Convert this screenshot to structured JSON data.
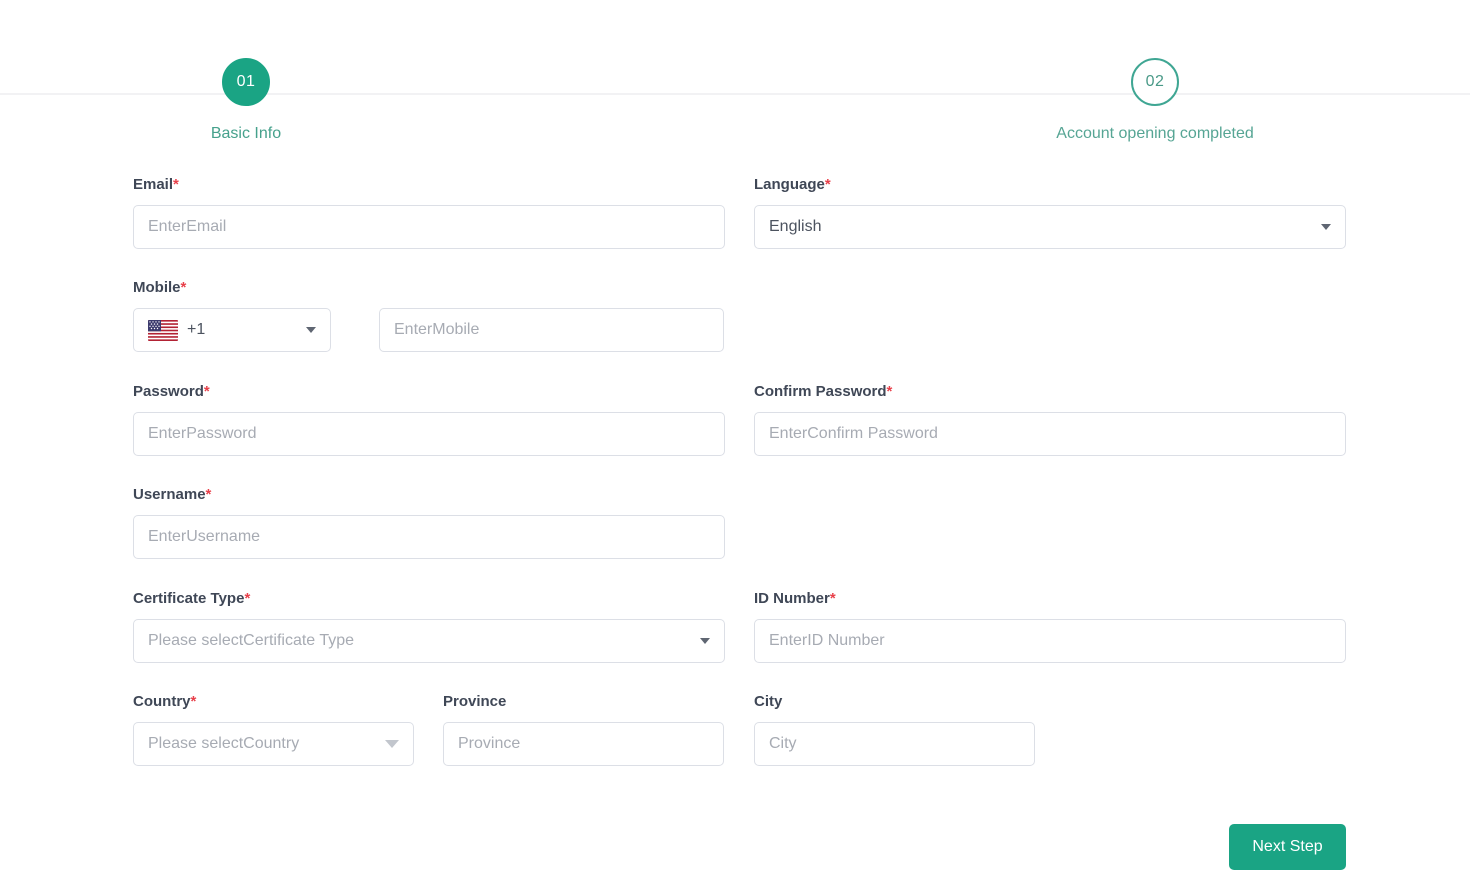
{
  "stepper": {
    "steps": [
      {
        "number": "01",
        "label": "Basic Info",
        "state": "active"
      },
      {
        "number": "02",
        "label": "Account opening completed",
        "state": "inactive"
      }
    ]
  },
  "form": {
    "email": {
      "label": "Email",
      "required_mark": "*",
      "placeholder": "EnterEmail",
      "value": ""
    },
    "language": {
      "label": "Language",
      "required_mark": "*",
      "value": "English",
      "options": [
        "English"
      ]
    },
    "mobile": {
      "label": "Mobile",
      "required_mark": "*",
      "country_code": "+1",
      "flag": "us-flag-icon",
      "placeholder": "EnterMobile",
      "value": ""
    },
    "password": {
      "label": "Password",
      "required_mark": "*",
      "placeholder": "EnterPassword",
      "value": ""
    },
    "confirm_password": {
      "label": "Confirm Password",
      "required_mark": "*",
      "placeholder": "EnterConfirm Password",
      "value": ""
    },
    "username": {
      "label": "Username",
      "required_mark": "*",
      "placeholder": "EnterUsername",
      "value": ""
    },
    "certificate_type": {
      "label": "Certificate Type",
      "required_mark": "*",
      "value": "Please selectCertificate Type"
    },
    "id_number": {
      "label": "ID Number",
      "required_mark": "*",
      "placeholder": "EnterID Number",
      "value": ""
    },
    "country": {
      "label": "Country",
      "required_mark": "*",
      "value": "Please selectCountry"
    },
    "province": {
      "label": "Province",
      "required_mark": "",
      "placeholder": "Province",
      "value": ""
    },
    "city": {
      "label": "City",
      "required_mark": "",
      "placeholder": "City",
      "value": ""
    }
  },
  "actions": {
    "next_step": "Next Step"
  },
  "colors": {
    "accent": "#1aa484",
    "step_text": "#46a18c",
    "required": "#e8404a",
    "label": "#3f4756",
    "placeholder": "#a7abb3",
    "border": "#dcdfe6",
    "divider": "#f2f2f4",
    "background": "#ffffff"
  }
}
